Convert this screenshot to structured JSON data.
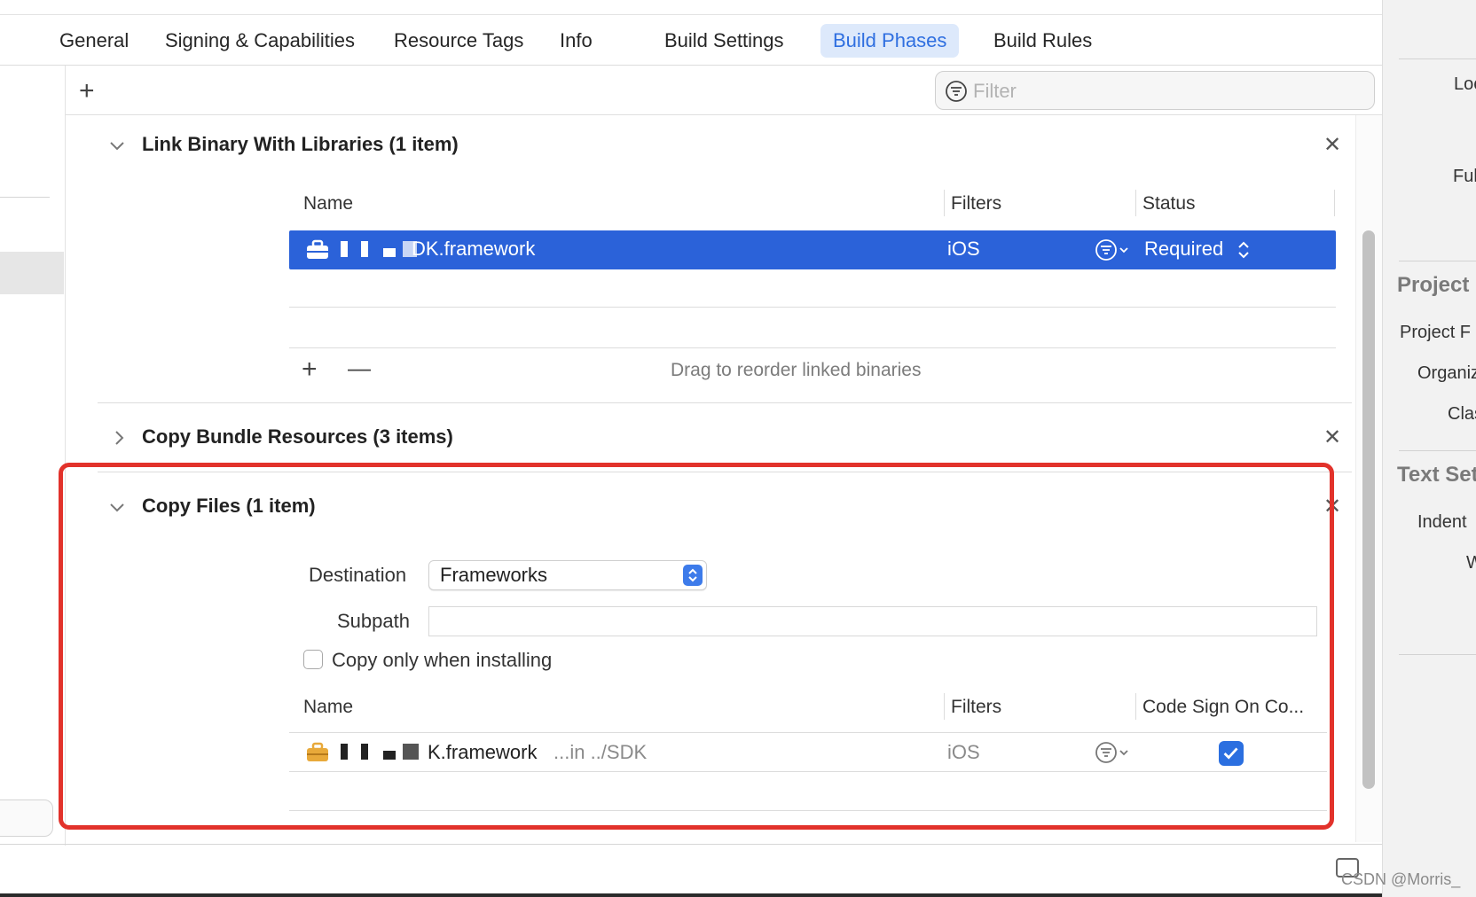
{
  "tabs": [
    {
      "label": "General",
      "active": false
    },
    {
      "label": "Signing & Capabilities",
      "active": false
    },
    {
      "label": "Resource Tags",
      "active": false
    },
    {
      "label": "Info",
      "active": false
    },
    {
      "label": "Build Settings",
      "active": false
    },
    {
      "label": "Build Phases",
      "active": true
    },
    {
      "label": "Build Rules",
      "active": false
    }
  ],
  "toolbar": {
    "add_label": "+",
    "filter_placeholder": "Filter"
  },
  "phases": {
    "link_binary": {
      "title": "Link Binary With Libraries (1 item)",
      "columns": [
        "Name",
        "Filters",
        "Status"
      ],
      "row": {
        "name": "DK.framework",
        "filters": "iOS",
        "status": "Required"
      },
      "add_label": "+",
      "remove_label": "—",
      "hint": "Drag to reorder linked binaries"
    },
    "copy_bundle": {
      "title": "Copy Bundle Resources (3 items)"
    },
    "copy_files": {
      "title": "Copy Files (1 item)",
      "destination_label": "Destination",
      "destination_value": "Frameworks",
      "subpath_label": "Subpath",
      "subpath_value": "",
      "copy_only_label": "Copy only when installing",
      "copy_only_checked": false,
      "columns": [
        "Name",
        "Filters",
        "Code Sign On Co..."
      ],
      "row": {
        "name": "K.framework",
        "location": "...in ../SDK",
        "filters": "iOS",
        "code_sign": true
      }
    }
  },
  "close_label": "✕",
  "inspector": {
    "items": [
      "Loc",
      "Ful"
    ],
    "project_heading": "Project",
    "project_items": [
      "Project F",
      "Organiz",
      "Class"
    ],
    "text_heading": "Text Set",
    "text_items": [
      "Indent",
      "W"
    ]
  },
  "watermark": "CSDN @Morris_",
  "colors": {
    "accent": "#2b62d9",
    "active_tab_bg": "#dde9fb",
    "highlight_box": "#e2322b",
    "toolbox_icon": "#e8a93a"
  }
}
